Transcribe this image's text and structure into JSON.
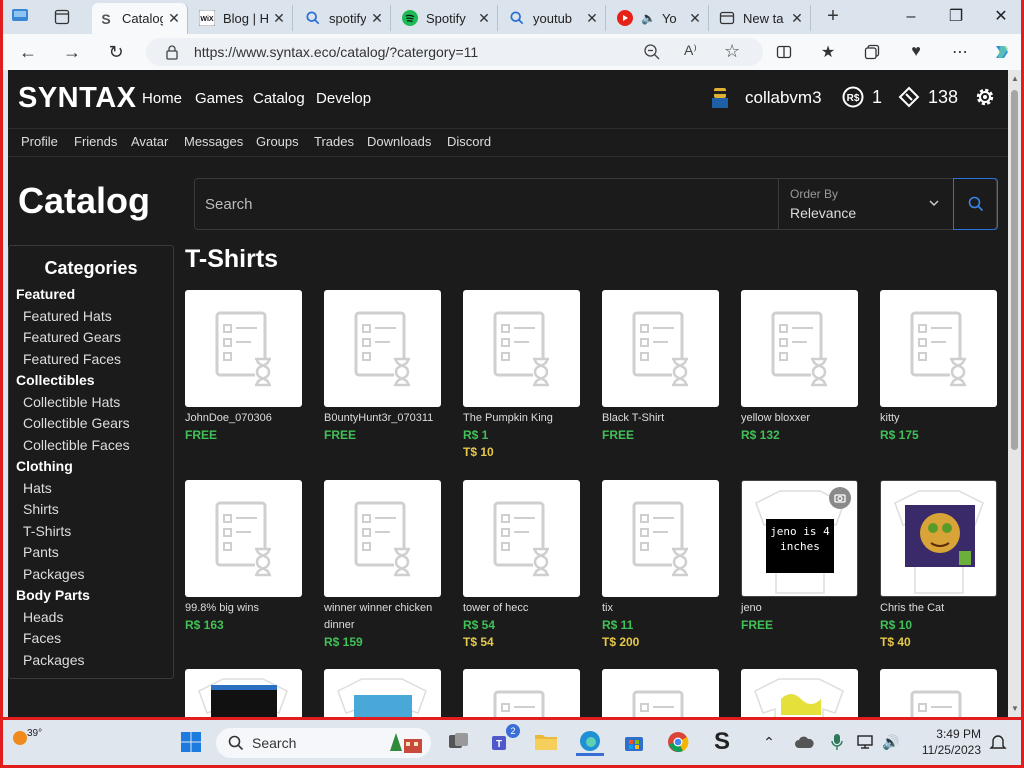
{
  "browser": {
    "tabs": [
      {
        "title": "Catalog",
        "favicon": "syntax-icon",
        "active": true
      },
      {
        "title": "Blog | H",
        "favicon": "wix-icon"
      },
      {
        "title": "spotify",
        "favicon": "search-icon"
      },
      {
        "title": "Spotify",
        "favicon": "spotify-icon"
      },
      {
        "title": "youtub",
        "favicon": "search-icon"
      },
      {
        "title": "Yo",
        "favicon": "youtube-icon"
      },
      {
        "title": "New ta",
        "favicon": "newtab-icon"
      }
    ],
    "url": "https://www.syntax.eco/catalog/?catergory=11",
    "readaloud": "A⁾"
  },
  "site": {
    "logo": "SYNTAX",
    "nav": [
      "Home",
      "Games",
      "Catalog",
      "Develop"
    ],
    "username": "collabvm3",
    "robux": "1",
    "tix": "138",
    "subnav": [
      "Profile",
      "Friends",
      "Avatar",
      "Messages",
      "Groups",
      "Trades",
      "Downloads",
      "Discord"
    ]
  },
  "catalog": {
    "title": "Catalog",
    "search_placeholder": "Search",
    "order_label": "Order By",
    "order_value": "Relevance",
    "categories_title": "Categories",
    "categories": [
      {
        "group": "Featured",
        "items": [
          "Featured Hats",
          "Featured Gears",
          "Featured Faces"
        ]
      },
      {
        "group": "Collectibles",
        "items": [
          "Collectible Hats",
          "Collectible Gears",
          "Collectible Faces"
        ]
      },
      {
        "group": "Clothing",
        "items": [
          "Hats",
          "Shirts",
          "T-Shirts",
          "Pants",
          "Packages"
        ]
      },
      {
        "group": "Body Parts",
        "items": [
          "Heads",
          "Faces",
          "Packages"
        ]
      }
    ],
    "section_title": "T-Shirts",
    "items": [
      {
        "name": "JohnDoe_070306",
        "prices": [
          {
            "type": "free",
            "text": "FREE"
          }
        ],
        "thumb": "pending"
      },
      {
        "name": "B0untyHunt3r_070311",
        "prices": [
          {
            "type": "free",
            "text": "FREE"
          }
        ],
        "thumb": "pending"
      },
      {
        "name": "The Pumpkin King",
        "prices": [
          {
            "type": "rs",
            "text": "R$ 1"
          },
          {
            "type": "ts",
            "text": "T$ 10"
          }
        ],
        "thumb": "pending"
      },
      {
        "name": "Black T-Shirt",
        "prices": [
          {
            "type": "free",
            "text": "FREE"
          }
        ],
        "thumb": "pending"
      },
      {
        "name": "yellow bloxxer",
        "prices": [
          {
            "type": "rs",
            "text": "R$ 132"
          }
        ],
        "thumb": "pending"
      },
      {
        "name": "kitty",
        "prices": [
          {
            "type": "rs",
            "text": "R$ 175"
          }
        ],
        "thumb": "pending"
      },
      {
        "name": "99.8% big wins",
        "prices": [
          {
            "type": "rs",
            "text": "R$ 163"
          }
        ],
        "thumb": "pending"
      },
      {
        "name": "winner winner chicken dinner",
        "prices": [
          {
            "type": "rs",
            "text": "R$ 159"
          }
        ],
        "thumb": "pending"
      },
      {
        "name": "tower of hecc",
        "prices": [
          {
            "type": "rs",
            "text": "R$ 54"
          },
          {
            "type": "ts",
            "text": "T$ 54"
          }
        ],
        "thumb": "pending"
      },
      {
        "name": "tix",
        "prices": [
          {
            "type": "rs",
            "text": "R$ 11"
          },
          {
            "type": "ts",
            "text": "T$ 200"
          }
        ],
        "thumb": "pending"
      },
      {
        "name": "jeno",
        "prices": [
          {
            "type": "free",
            "text": "FREE"
          }
        ],
        "thumb": "shirt-text",
        "shirt_text": "jeno is 4 inches"
      },
      {
        "name": "Chris the Cat",
        "prices": [
          {
            "type": "rs",
            "text": "R$ 10"
          },
          {
            "type": "ts",
            "text": "T$ 40"
          }
        ],
        "thumb": "shirt-cat"
      },
      {
        "name": "",
        "prices": [],
        "thumb": "shirt-dark"
      },
      {
        "name": "",
        "prices": [],
        "thumb": "shirt-blue"
      },
      {
        "name": "",
        "prices": [],
        "thumb": "pending"
      },
      {
        "name": "",
        "prices": [],
        "thumb": "pending"
      },
      {
        "name": "",
        "prices": [],
        "thumb": "shirt-yellow"
      },
      {
        "name": "",
        "prices": [],
        "thumb": "pending"
      }
    ]
  },
  "taskbar": {
    "temperature": "39°",
    "search_label": "Search",
    "time": "3:49 PM",
    "date": "11/25/2023",
    "teams_badge": "2"
  }
}
